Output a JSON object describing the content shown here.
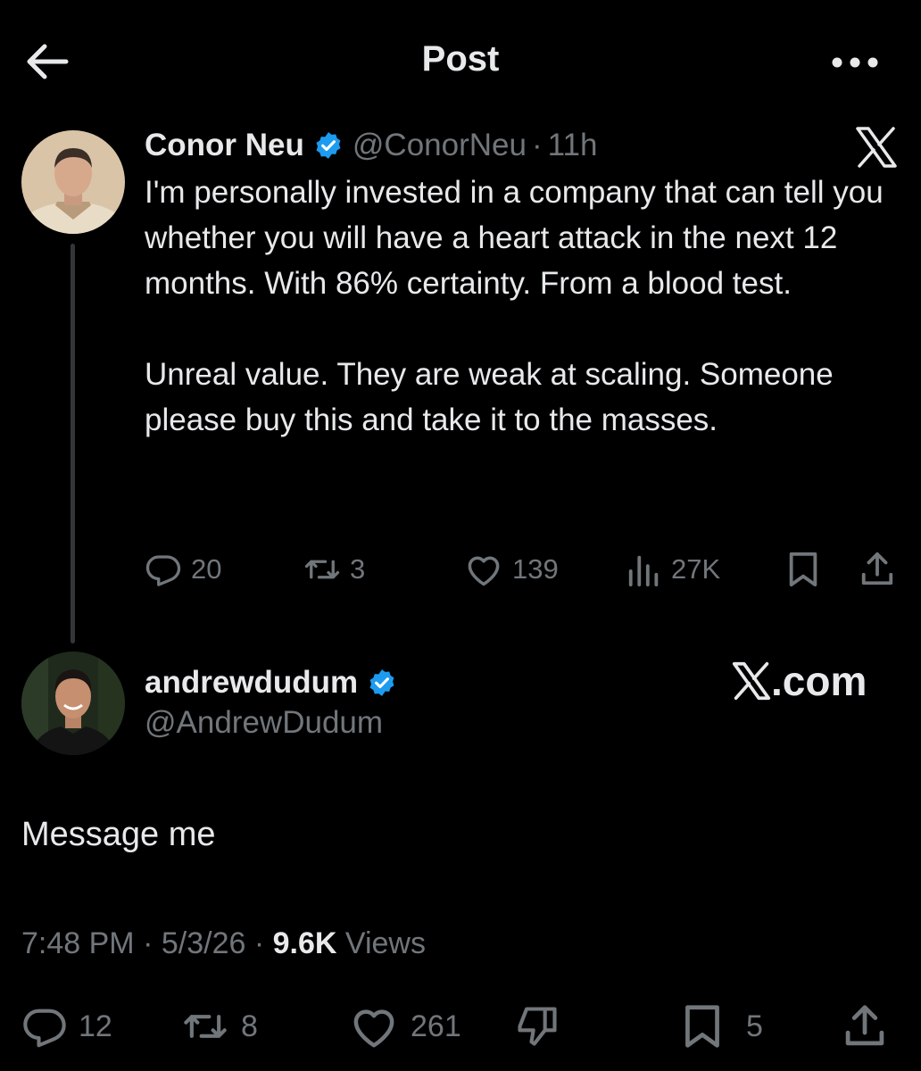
{
  "header": {
    "title": "Post"
  },
  "quoted_post": {
    "author_name": "Conor Neu",
    "author_handle": "@ConorNeu",
    "separator": "·",
    "time": "11h",
    "text": "I'm personally invested in a company that can tell you whether you will have a heart attack in the next 12 months. With 86% certainty. From a blood test.\n\nUnreal value. They are weak at scaling. Someone please buy this and take it to the masses.",
    "stats": {
      "replies": "20",
      "reposts": "3",
      "likes": "139",
      "views": "27K"
    }
  },
  "reply_post": {
    "author_name": "andrewdudum",
    "author_handle": "@AndrewDudum",
    "source_label": ".com",
    "text": "Message me",
    "timestamp_time": "7:48 PM",
    "timestamp_date": "5/3/26",
    "views_count": "9.6K",
    "views_label": "Views",
    "separator": "·",
    "stats": {
      "replies": "12",
      "reposts": "8",
      "likes": "261",
      "bookmarks": "5"
    }
  },
  "colors": {
    "background": "#000000",
    "text": "#e7e9ea",
    "muted": "#71767b",
    "verified": "#1d9bf0",
    "thread_line": "#333639"
  },
  "icons": [
    "back-arrow-icon",
    "more-icon",
    "verified-icon",
    "x-logo-icon",
    "reply-icon",
    "repost-icon",
    "like-icon",
    "views-icon",
    "bookmark-icon",
    "share-icon",
    "dislike-icon"
  ]
}
